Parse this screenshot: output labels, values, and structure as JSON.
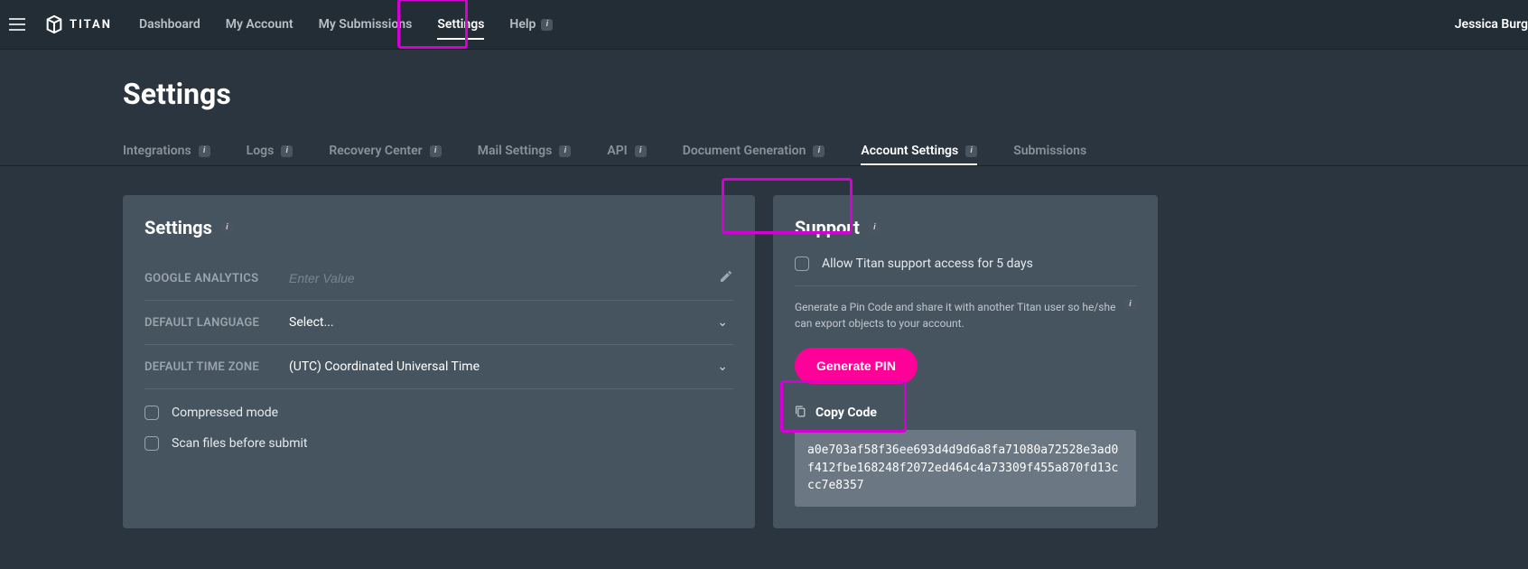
{
  "brand": "TITAN",
  "main_nav": {
    "dashboard": "Dashboard",
    "my_account": "My Account",
    "my_submissions": "My Submissions",
    "settings": "Settings",
    "help": "Help"
  },
  "user": "Jessica Burg",
  "page_title": "Settings",
  "sub_nav": {
    "integrations": "Integrations",
    "logs": "Logs",
    "recovery": "Recovery Center",
    "mail": "Mail Settings",
    "api": "API",
    "docgen": "Document Generation",
    "account": "Account Settings",
    "submissions": "Submissions"
  },
  "left_panel": {
    "title": "Settings",
    "ga_label": "GOOGLE ANALYTICS",
    "ga_placeholder": "Enter Value",
    "lang_label": "DEFAULT LANGUAGE",
    "lang_value": "Select...",
    "tz_label": "DEFAULT TIME ZONE",
    "tz_value": "(UTC) Coordinated Universal Time",
    "compressed": "Compressed mode",
    "scan": "Scan files before submit"
  },
  "right_panel": {
    "title": "Support",
    "allow_access": "Allow Titan support access for 5 days",
    "pin_text": "Generate a Pin Code and share it with another Titan user so he/she can export objects to your account.",
    "generate": "Generate PIN",
    "copy": "Copy Code",
    "code": "a0e703af58f36ee693d4d9d6a8fa71080a72528e3ad0f412fbe168248f2072ed464c4a73309f455a870fd13ccc7e8357"
  }
}
